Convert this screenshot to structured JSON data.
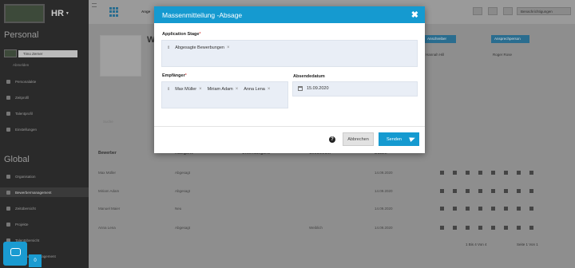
{
  "sidebar": {
    "brand_label": "HR",
    "personal_title": "Personal",
    "user_name": "Timo Zerner",
    "user_sub": "Abmelden",
    "personal_items": [
      "Personalakte",
      "Zeitprofil",
      "Talentprofil",
      "Einstellungen"
    ],
    "global_title": "Global",
    "global_items": [
      "Organisation",
      "Bewerbermanagement",
      "Zeitübersicht",
      "Projekte",
      "Talentübersicht",
      "Verwaltungsmanagement"
    ]
  },
  "topbar": {
    "breadcrumb": "Ange",
    "notifications_label": "Benachrichtigungen"
  },
  "background": {
    "heading_initial": "W",
    "btn_left": "Anschreiber",
    "btn_right": "Ansprechperson",
    "text_left": "Hannah Hill",
    "text_right": "Roger Rose",
    "search_placeholder": "Suche",
    "table": {
      "headers": [
        "Bewerber",
        "Kategorie",
        "Unterkategorie",
        "Geschlecht",
        "Datum"
      ],
      "rows": [
        [
          "Max Müller",
          "Abgesagt",
          "",
          "",
          "14.09.2020"
        ],
        [
          "Miriam Adam",
          "Abgesagt",
          "",
          "",
          "14.09.2020"
        ],
        [
          "Manuel Maier",
          "Neu",
          "",
          "",
          "14.09.2020"
        ],
        [
          "Anna Lena",
          "Abgesagt",
          "",
          "Weiblich",
          "14.09.2020"
        ]
      ]
    },
    "pagination": "1 Bis 4 Von 4",
    "page_label": "Seite 1 Von 1"
  },
  "modal": {
    "title": "Massenmitteilung -Absage",
    "stage_label": "Application Stage",
    "stage_values": [
      "Abgesagte Bewerbungen"
    ],
    "recipients_label": "Empfänger",
    "recipients": [
      "Max Müller",
      "Miriam Adam",
      "Anna Lena"
    ],
    "send_date_label": "Absendedatum",
    "send_date_value": "15.09.2020",
    "cancel_label": "Abbrechen",
    "send_label": "Senden"
  },
  "chat_badge": "0"
}
